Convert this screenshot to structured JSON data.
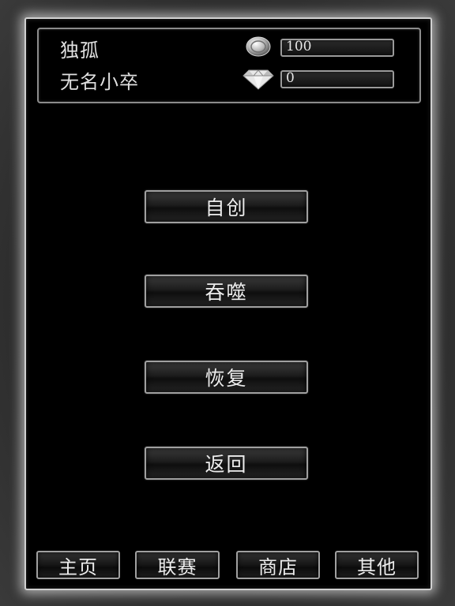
{
  "player": {
    "name": "独孤",
    "rank": "无名小卒"
  },
  "resources": {
    "coins": {
      "icon": "coin-icon",
      "value": "100"
    },
    "gems": {
      "icon": "diamond-icon",
      "value": "0"
    }
  },
  "menu": {
    "create": "自创",
    "devour": "吞噬",
    "restore": "恢复",
    "back": "返回"
  },
  "nav": {
    "home": "主页",
    "league": "联赛",
    "shop": "商店",
    "other": "其他"
  },
  "colors": {
    "background": "#000000",
    "frame": "#d0d0d0",
    "text": "#e6e6e6"
  }
}
